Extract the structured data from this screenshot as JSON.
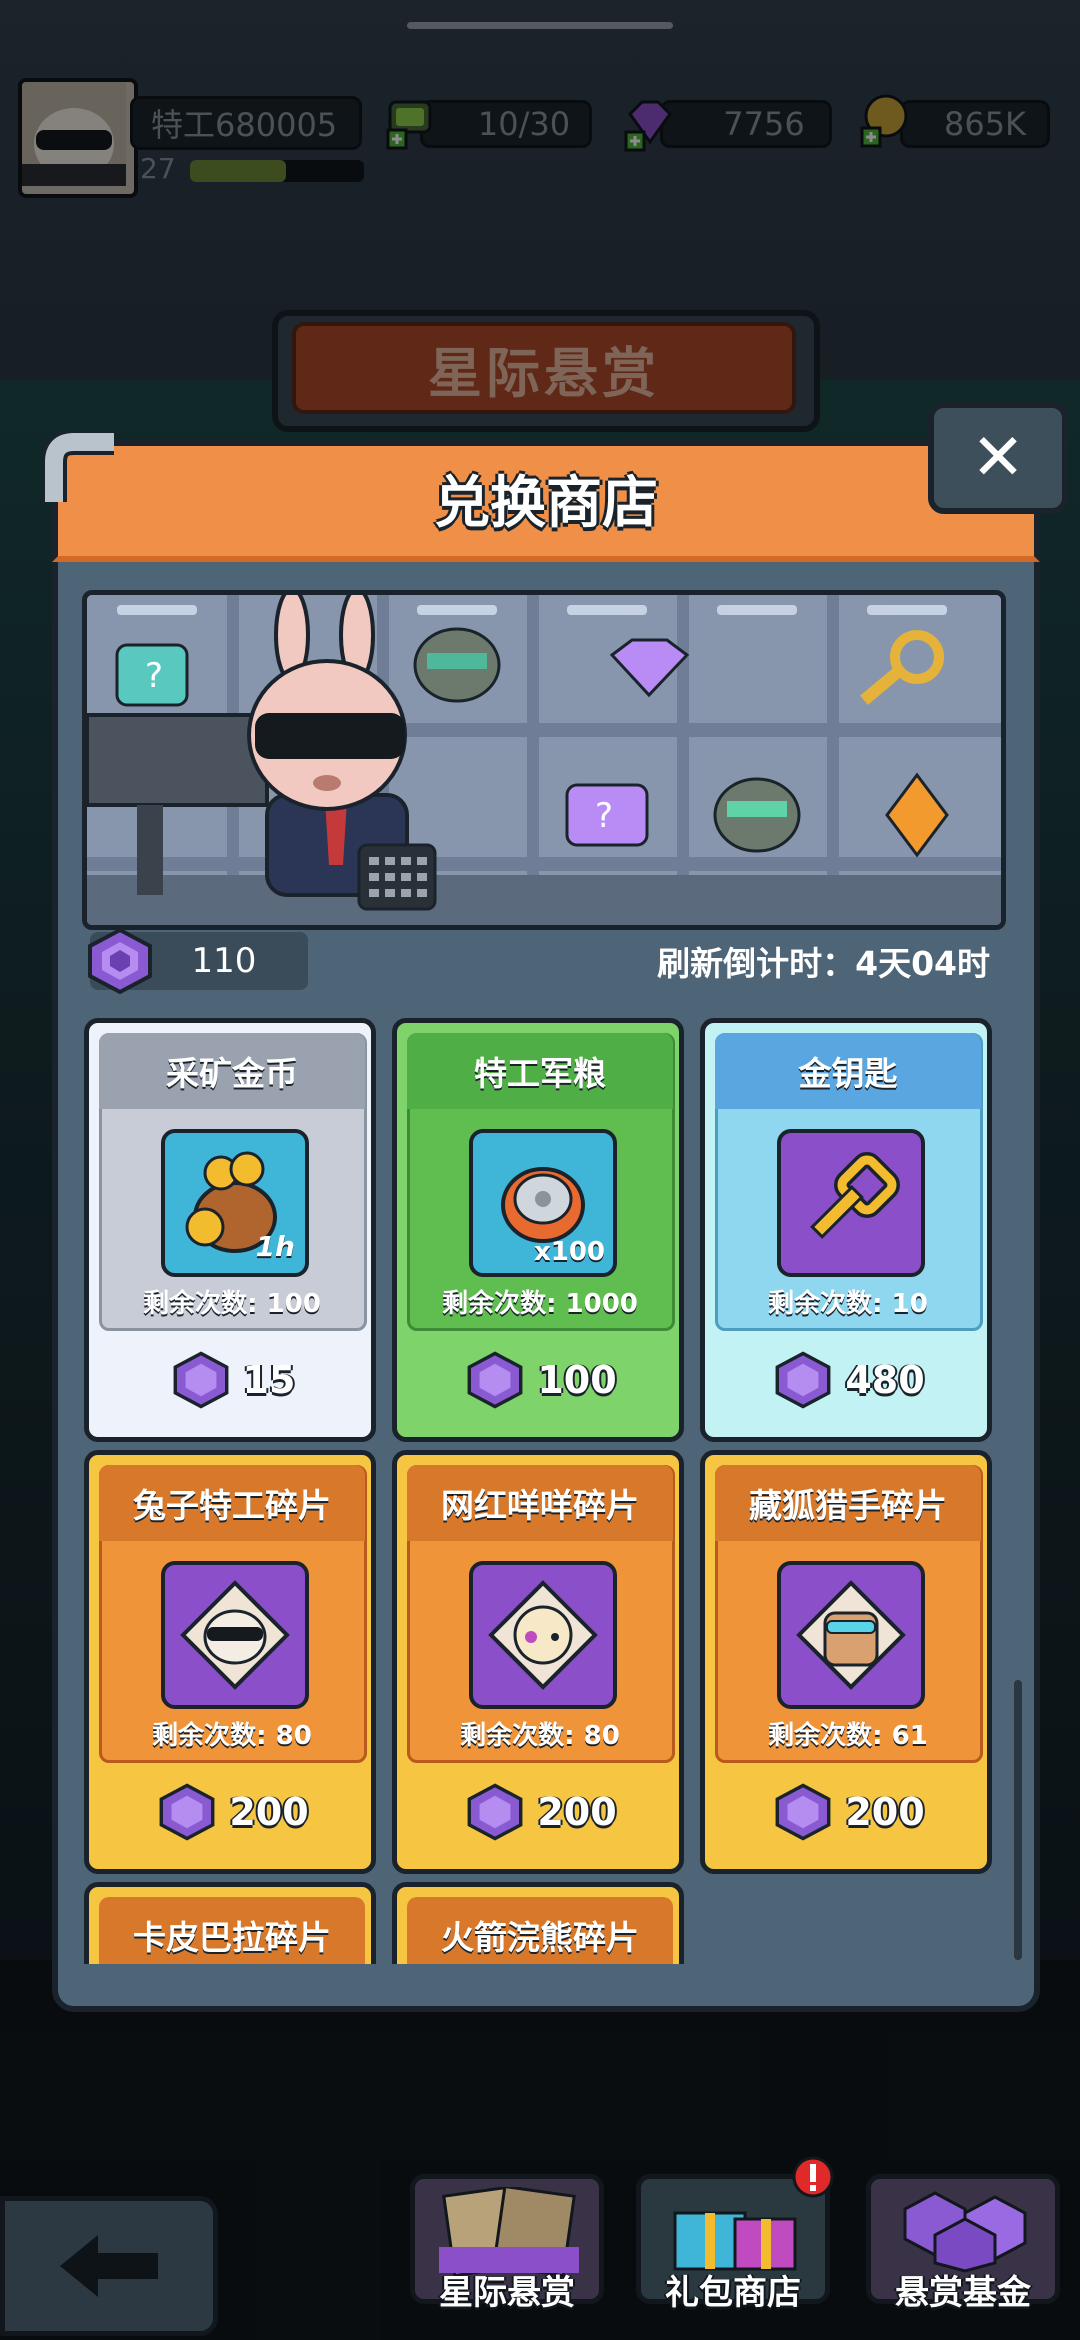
{
  "player": {
    "name": "特工680005",
    "level": "27",
    "xp_fraction": 0.55
  },
  "resources": {
    "energy": "10/30",
    "gems": "7756",
    "coins": "865K"
  },
  "background_banner": "星际悬赏",
  "modal": {
    "title": "兑换商店",
    "close_icon": "close-icon"
  },
  "shop": {
    "currency_amount": "110",
    "refresh_label": "刷新倒计时：4天04时"
  },
  "items": [
    {
      "name": "采矿金币",
      "remaining": "剩余次数: 100",
      "price": "15",
      "badge": "1h",
      "theme": "gray"
    },
    {
      "name": "特工军粮",
      "remaining": "剩余次数: 1000",
      "price": "100",
      "badge": "x100",
      "theme": "green"
    },
    {
      "name": "金钥匙",
      "remaining": "剩余次数: 10",
      "price": "480",
      "badge": "",
      "theme": "blue"
    },
    {
      "name": "兔子特工碎片",
      "remaining": "剩余次数: 80",
      "price": "200",
      "badge": "",
      "theme": "orange"
    },
    {
      "name": "网红咩咩碎片",
      "remaining": "剩余次数: 80",
      "price": "200",
      "badge": "",
      "theme": "orange"
    },
    {
      "name": "藏狐猎手碎片",
      "remaining": "剩余次数: 61",
      "price": "200",
      "badge": "",
      "theme": "orange"
    },
    {
      "name": "卡皮巴拉碎片",
      "theme": "orange"
    },
    {
      "name": "火箭浣熊碎片",
      "theme": "orange"
    }
  ],
  "bottom_nav": {
    "tabs": [
      {
        "label": "星际悬赏"
      },
      {
        "label": "礼包商店"
      },
      {
        "label": "悬赏基金"
      }
    ]
  },
  "colors": {
    "header_orange": "#f09048",
    "card_gray": "#c7ccd6",
    "card_green": "#7ed36a",
    "card_blue": "#8fd6ef",
    "card_orange": "#f6c642",
    "currency_purple": "#8a5ad2"
  }
}
